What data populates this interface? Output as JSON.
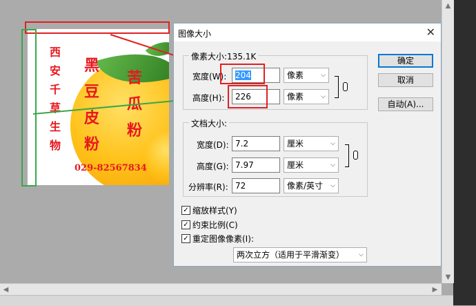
{
  "dialog": {
    "title": "图像大小",
    "close_glyph": "✕",
    "pixel_dims": {
      "legend": "像素大小:135.1K",
      "width_label": "宽度(W):",
      "width_value": "204",
      "width_unit": "像素",
      "height_label": "高度(H):",
      "height_value": "226",
      "height_unit": "像素"
    },
    "doc_size": {
      "legend": "文档大小:",
      "width_label": "宽度(D):",
      "width_value": "7.2",
      "width_unit": "厘米",
      "height_label": "高度(G):",
      "height_value": "7.97",
      "height_unit": "厘米",
      "res_label": "分辨率(R):",
      "res_value": "72",
      "res_unit": "像素/英寸"
    },
    "buttons": {
      "ok": "确定",
      "cancel": "取消",
      "auto": "自动(A)..."
    },
    "checkboxes": {
      "scale_styles": "缩放样式(Y)",
      "constrain": "约束比例(C)",
      "resample": "重定图像像素(I):"
    },
    "resample_method": "两次立方（适用于平滑渐变）"
  },
  "image_text": {
    "col1": [
      "西",
      "安",
      "千",
      "草",
      "生",
      "物"
    ],
    "col2": [
      "黑",
      "豆",
      "皮",
      "粉"
    ],
    "col3": [
      "苦",
      "瓜",
      "粉"
    ],
    "phone": "029-82567834"
  },
  "colors": {
    "annotation_red": "#e02020",
    "annotation_green": "#3aa64a",
    "text_red": "#e8181f"
  }
}
